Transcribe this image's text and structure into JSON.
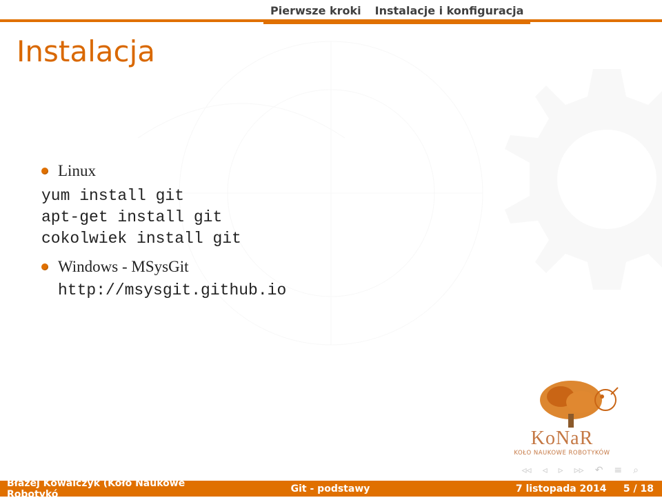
{
  "header": {
    "tab1": "Pierwsze kroki",
    "tab2": "Instalacje i konfiguracja"
  },
  "title": "Instalacja",
  "content": {
    "bullet1": "Linux",
    "code_line1": "yum install git",
    "code_line2": "apt-get install git",
    "code_line3": "cokolwiek install git",
    "bullet2": "Windows - MSysGit",
    "sub_link": "http://msysgit.github.io"
  },
  "logo": {
    "name": "KoNaR",
    "sub": "KOŁO NAUKOWE ROBOTYKÓW"
  },
  "nav": {
    "first": "◂◂",
    "prev": "◂",
    "next": "▸",
    "last": "▸▸",
    "back": "↶",
    "search": "🔍"
  },
  "footer": {
    "left": "Błażej Kowalczyk (Koło Naukowe Robotykó",
    "center": "Git - podstawy",
    "date": "7 listopada 2014",
    "page_current": "5",
    "page_sep": " / ",
    "page_total": "18"
  }
}
